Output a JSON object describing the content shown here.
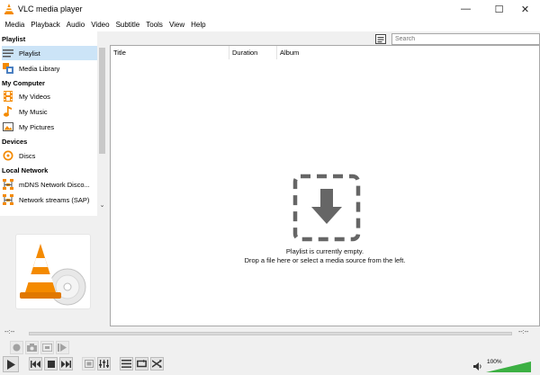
{
  "window": {
    "title": "VLC media player"
  },
  "window_controls": {
    "minimize": "—",
    "maximize": "☐",
    "close": "✕"
  },
  "menu": [
    "Media",
    "Playback",
    "Audio",
    "Video",
    "Subtitle",
    "Tools",
    "View",
    "Help"
  ],
  "sidebar": {
    "sections": [
      {
        "header": "Playlist",
        "items": [
          {
            "label": "Playlist",
            "icon": "playlist-icon",
            "selected": true
          },
          {
            "label": "Media Library",
            "icon": "media-library-icon"
          }
        ]
      },
      {
        "header": "My Computer",
        "items": [
          {
            "label": "My Videos",
            "icon": "film-icon"
          },
          {
            "label": "My Music",
            "icon": "music-note-icon"
          },
          {
            "label": "My Pictures",
            "icon": "picture-icon"
          }
        ]
      },
      {
        "header": "Devices",
        "items": [
          {
            "label": "Discs",
            "icon": "disc-icon"
          }
        ]
      },
      {
        "header": "Local Network",
        "items": [
          {
            "label": "mDNS Network Disco...",
            "icon": "network-icon"
          },
          {
            "label": "Network streams (SAP)",
            "icon": "network-icon"
          }
        ]
      }
    ]
  },
  "search": {
    "placeholder": "Search"
  },
  "playlist": {
    "columns": [
      "Title",
      "Duration",
      "Album"
    ],
    "empty_line1": "Playlist is currently empty.",
    "empty_line2": "Drop a file here or select a media source from the left."
  },
  "seek": {
    "elapsed": "--:--",
    "remaining": "--:--"
  },
  "volume": {
    "label": "100%",
    "level": 1.0
  },
  "colors": {
    "accent_orange": "#f48a00",
    "selection": "#cce4f7",
    "volume_green": "#3cb043"
  }
}
